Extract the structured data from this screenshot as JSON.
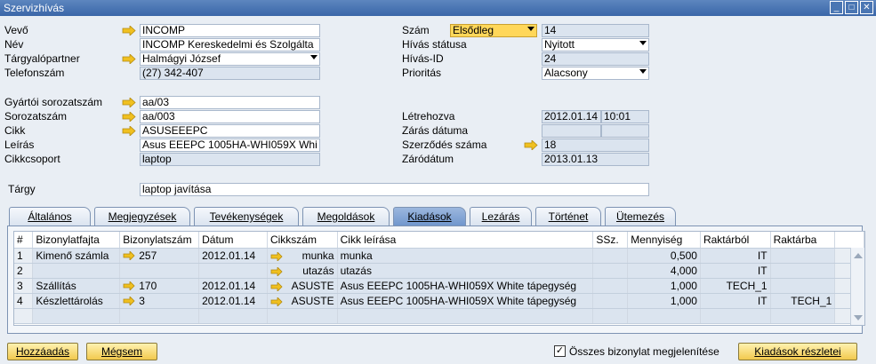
{
  "window": {
    "title": "Szervizhívás"
  },
  "left": {
    "vevo": {
      "label": "Vevő",
      "value": "INCOMP"
    },
    "nev": {
      "label": "Név",
      "value": "INCOMP Kereskedelmi és Szolgálta"
    },
    "partner": {
      "label": "Tárgyalópartner",
      "value": "Halmágyi József"
    },
    "telefon": {
      "label": "Telefonszám",
      "value": "(27) 342-407"
    },
    "gyartoi": {
      "label": "Gyártói sorozatszám",
      "value": "aa/03"
    },
    "sorozat": {
      "label": "Sorozatszám",
      "value": "aa/003"
    },
    "cikk": {
      "label": "Cikk",
      "value": "ASUSEEEPC"
    },
    "leiras": {
      "label": "Leírás",
      "value": "Asus EEEPC 1005HA-WHI059X Whi"
    },
    "cikkcsoport": {
      "label": "Cikkcsoport",
      "value": "laptop"
    },
    "targy": {
      "label": "Tárgy",
      "value": "laptop javítása"
    }
  },
  "right": {
    "szam": {
      "label": "Szám",
      "series": "Elsődleg",
      "value": "14"
    },
    "statusz": {
      "label": "Hívás státusa",
      "value": "Nyitott"
    },
    "hivasid": {
      "label": "Hívás-ID",
      "value": "24"
    },
    "prioritas": {
      "label": "Prioritás",
      "value": "Alacsony"
    },
    "letrehozva": {
      "label": "Létrehozva",
      "date": "2012.01.14",
      "time": "10:01"
    },
    "zaras": {
      "label": "Zárás dátuma",
      "date": "",
      "time": ""
    },
    "szerzodes": {
      "label": "Szerződés száma",
      "value": "18"
    },
    "zarodatum": {
      "label": "Záródátum",
      "value": "2013.01.13"
    }
  },
  "tabs": [
    {
      "label": "Általános"
    },
    {
      "label": "Megjegyzések"
    },
    {
      "label": "Tevékenységek"
    },
    {
      "label": "Megoldások"
    },
    {
      "label": "Kiadások"
    },
    {
      "label": "Lezárás"
    },
    {
      "label": "Történet"
    },
    {
      "label": "Ütemezés"
    }
  ],
  "grid": {
    "headers": [
      "#",
      "Bizonylatfajta",
      "Bizonylatszám",
      "Dátum",
      "Cikkszám",
      "Cikk leírása",
      "SSz.",
      "Mennyiség",
      "Raktárból",
      "Raktárba"
    ],
    "rows": [
      {
        "n": "1",
        "fajta": "Kimenő számla",
        "szam": "257",
        "datum": "2012.01.14",
        "cikkszam": "munka",
        "leiras": "munka",
        "ssz": "",
        "menny": "0,500",
        "rakbol": "IT",
        "rakba": ""
      },
      {
        "n": "2",
        "fajta": "",
        "szam": "",
        "datum": "",
        "cikkszam": "utazás",
        "leiras": "utazás",
        "ssz": "",
        "menny": "4,000",
        "rakbol": "IT",
        "rakba": ""
      },
      {
        "n": "3",
        "fajta": "Szállítás",
        "szam": "170",
        "datum": "2012.01.14",
        "cikkszam": "ASUSTE",
        "leiras": "Asus EEEPC 1005HA-WHI059X White tápegység",
        "ssz": "",
        "menny": "1,000",
        "rakbol": "TECH_1",
        "rakba": ""
      },
      {
        "n": "4",
        "fajta": "Készlettárolás",
        "szam": "3",
        "datum": "2012.01.14",
        "cikkszam": "ASUSTE",
        "leiras": "Asus EEEPC 1005HA-WHI059X White tápegység",
        "ssz": "",
        "menny": "1,000",
        "rakbol": "IT",
        "rakba": "TECH_1"
      }
    ]
  },
  "footer": {
    "add": "Hozzáadás",
    "cancel": "Mégsem",
    "show_all": "Összes bizonylat megjelenítése",
    "show_all_checked": true,
    "details": "Kiadások részletei"
  },
  "colors": {
    "arrow": "#f0c020",
    "titlebar": "#3a66a8",
    "readonly": "#dbe4ef",
    "button": "#f2c94e"
  }
}
